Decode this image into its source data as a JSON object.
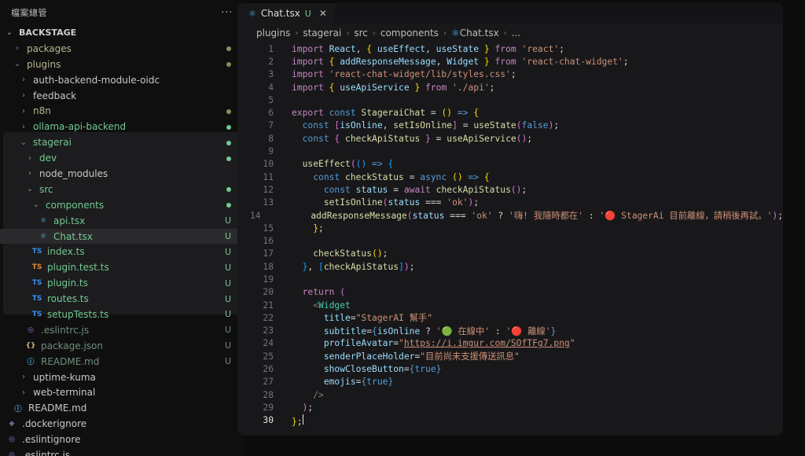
{
  "explorer": {
    "title": "檔案總管",
    "more": "···",
    "root": "BACKSTAGE",
    "items": [
      {
        "label": "packages",
        "depth": 1,
        "type": "folder",
        "open": false,
        "status": "dot",
        "color": "olive"
      },
      {
        "label": "plugins",
        "depth": 1,
        "type": "folder",
        "open": true,
        "status": "dot",
        "color": "olive"
      },
      {
        "label": "auth-backend-module-oidc",
        "depth": 2,
        "type": "folder",
        "open": false,
        "status": "",
        "color": "normal"
      },
      {
        "label": "feedback",
        "depth": 2,
        "type": "folder",
        "open": false,
        "status": "",
        "color": "normal"
      },
      {
        "label": "n8n",
        "depth": 2,
        "type": "folder",
        "open": false,
        "status": "dot",
        "color": "olive"
      },
      {
        "label": "ollama-api-backend",
        "depth": 2,
        "type": "folder",
        "open": false,
        "status": "dot",
        "color": "green"
      },
      {
        "label": "stagerai",
        "depth": 2,
        "type": "folder",
        "open": true,
        "status": "dot",
        "color": "green"
      },
      {
        "label": "dev",
        "depth": 3,
        "type": "folder",
        "open": false,
        "status": "dot",
        "color": "green"
      },
      {
        "label": "node_modules",
        "depth": 3,
        "type": "folder",
        "open": false,
        "status": "",
        "color": "normal"
      },
      {
        "label": "src",
        "depth": 3,
        "type": "folder",
        "open": true,
        "status": "dot",
        "color": "green"
      },
      {
        "label": "components",
        "depth": 4,
        "type": "folder",
        "open": true,
        "status": "dot",
        "color": "green"
      },
      {
        "label": "api.tsx",
        "depth": 5,
        "type": "react",
        "status": "U",
        "color": "green"
      },
      {
        "label": "Chat.tsx",
        "depth": 5,
        "type": "react",
        "status": "U",
        "color": "green",
        "selected": true
      },
      {
        "label": "index.ts",
        "depth": 4,
        "type": "ts",
        "status": "U",
        "color": "green"
      },
      {
        "label": "plugin.test.ts",
        "depth": 4,
        "type": "tstest",
        "status": "U",
        "color": "green"
      },
      {
        "label": "plugin.ts",
        "depth": 4,
        "type": "ts",
        "status": "U",
        "color": "green"
      },
      {
        "label": "routes.ts",
        "depth": 4,
        "type": "ts",
        "status": "U",
        "color": "green"
      },
      {
        "label": "setupTests.ts",
        "depth": 4,
        "type": "ts",
        "status": "U",
        "color": "green"
      },
      {
        "label": ".eslintrc.js",
        "depth": 3,
        "type": "eslint",
        "status": "U",
        "color": "dim"
      },
      {
        "label": "package.json",
        "depth": 3,
        "type": "json",
        "status": "U",
        "color": "dim"
      },
      {
        "label": "README.md",
        "depth": 3,
        "type": "info",
        "status": "U",
        "color": "dim"
      },
      {
        "label": "uptime-kuma",
        "depth": 2,
        "type": "folder",
        "open": false,
        "status": "",
        "color": "normal"
      },
      {
        "label": "web-terminal",
        "depth": 2,
        "type": "folder",
        "open": false,
        "status": "",
        "color": "normal"
      },
      {
        "label": "README.md",
        "depth": 1,
        "type": "info",
        "status": "",
        "color": "normal"
      },
      {
        "label": ".dockerignore",
        "depth": 0,
        "type": "docker",
        "status": "",
        "color": "normal"
      },
      {
        "label": ".eslintignore",
        "depth": 0,
        "type": "eslint",
        "status": "",
        "color": "normal"
      },
      {
        "label": ".eslintrc.js",
        "depth": 0,
        "type": "eslint",
        "status": "",
        "color": "normal"
      }
    ]
  },
  "editor": {
    "tab": {
      "label": "Chat.tsx",
      "modified": "U",
      "close": "✕"
    },
    "breadcrumb": [
      "plugins",
      "stagerai",
      "src",
      "components",
      "Chat.tsx",
      "..."
    ],
    "active_line": 30,
    "lines": [
      [
        [
          "k",
          "import "
        ],
        [
          "v",
          "React"
        ],
        [
          "p",
          ", "
        ],
        [
          "br1",
          "{ "
        ],
        [
          "v",
          "useEffect"
        ],
        [
          "p",
          ", "
        ],
        [
          "v",
          "useState"
        ],
        [
          "br1",
          " }"
        ],
        [
          "k",
          " from "
        ],
        [
          "s",
          "'react'"
        ],
        [
          "p",
          ";"
        ]
      ],
      [
        [
          "k",
          "import "
        ],
        [
          "br1",
          "{ "
        ],
        [
          "v",
          "addResponseMessage"
        ],
        [
          "p",
          ", "
        ],
        [
          "v",
          "Widget"
        ],
        [
          "br1",
          " }"
        ],
        [
          "k",
          " from "
        ],
        [
          "s",
          "'react-chat-widget'"
        ],
        [
          "p",
          ";"
        ]
      ],
      [
        [
          "k",
          "import "
        ],
        [
          "s",
          "'react-chat-widget/lib/styles.css'"
        ],
        [
          "p",
          ";"
        ]
      ],
      [
        [
          "k",
          "import "
        ],
        [
          "br1",
          "{ "
        ],
        [
          "v",
          "useApiService"
        ],
        [
          "br1",
          " }"
        ],
        [
          "k",
          " from "
        ],
        [
          "s",
          "'./api'"
        ],
        [
          "p",
          ";"
        ]
      ],
      [],
      [
        [
          "k",
          "export "
        ],
        [
          "k2",
          "const "
        ],
        [
          "f",
          "StageraiChat"
        ],
        [
          "p",
          " = "
        ],
        [
          "br1",
          "("
        ],
        [
          "br1",
          ")"
        ],
        [
          "k2",
          " => "
        ],
        [
          "br1",
          "{"
        ]
      ],
      [
        [
          "p",
          "  "
        ],
        [
          "k2",
          "const "
        ],
        [
          "br2",
          "["
        ],
        [
          "v",
          "isOnline"
        ],
        [
          "p",
          ", "
        ],
        [
          "f",
          "setIsOnline"
        ],
        [
          "br2",
          "]"
        ],
        [
          "p",
          " = "
        ],
        [
          "f",
          "useState"
        ],
        [
          "br2",
          "("
        ],
        [
          "k2",
          "false"
        ],
        [
          "br2",
          ")"
        ],
        [
          "p",
          ";"
        ]
      ],
      [
        [
          "p",
          "  "
        ],
        [
          "k2",
          "const "
        ],
        [
          "br2",
          "{ "
        ],
        [
          "f",
          "checkApiStatus"
        ],
        [
          "br2",
          " }"
        ],
        [
          "p",
          " = "
        ],
        [
          "f",
          "useApiService"
        ],
        [
          "br2",
          "()"
        ],
        [
          "p",
          ";"
        ]
      ],
      [],
      [
        [
          "p",
          "  "
        ],
        [
          "f",
          "useEffect"
        ],
        [
          "br2",
          "("
        ],
        [
          "br3",
          "()"
        ],
        [
          "k2",
          " => "
        ],
        [
          "br3",
          "{"
        ]
      ],
      [
        [
          "p",
          "    "
        ],
        [
          "k2",
          "const "
        ],
        [
          "f",
          "checkStatus"
        ],
        [
          "p",
          " = "
        ],
        [
          "k2",
          "async "
        ],
        [
          "br1",
          "()"
        ],
        [
          "k2",
          " => "
        ],
        [
          "br1",
          "{"
        ]
      ],
      [
        [
          "p",
          "      "
        ],
        [
          "k2",
          "const "
        ],
        [
          "v",
          "status"
        ],
        [
          "p",
          " = "
        ],
        [
          "k",
          "await "
        ],
        [
          "f",
          "checkApiStatus"
        ],
        [
          "br2",
          "()"
        ],
        [
          "p",
          ";"
        ]
      ],
      [
        [
          "p",
          "      "
        ],
        [
          "f",
          "setIsOnline"
        ],
        [
          "br2",
          "("
        ],
        [
          "v",
          "status"
        ],
        [
          "p",
          " === "
        ],
        [
          "s",
          "'ok'"
        ],
        [
          "br2",
          ")"
        ],
        [
          "p",
          ";"
        ]
      ],
      [
        [
          "p",
          "      "
        ],
        [
          "f",
          "addResponseMessage"
        ],
        [
          "br2",
          "("
        ],
        [
          "v",
          "status"
        ],
        [
          "p",
          " === "
        ],
        [
          "s",
          "'ok'"
        ],
        [
          "p",
          " ? "
        ],
        [
          "s",
          "'嗨! 我隨時都在'"
        ],
        [
          "p",
          " : "
        ],
        [
          "s",
          "'🔴 StagerAi 目前離線，請稍後再試。'"
        ],
        [
          "br2",
          ")"
        ],
        [
          "p",
          ";"
        ]
      ],
      [
        [
          "p",
          "    "
        ],
        [
          "br1",
          "}"
        ],
        [
          "p",
          ";"
        ]
      ],
      [],
      [
        [
          "p",
          "    "
        ],
        [
          "f",
          "checkStatus"
        ],
        [
          "br1",
          "()"
        ],
        [
          "p",
          ";"
        ]
      ],
      [
        [
          "p",
          "  "
        ],
        [
          "br3",
          "}"
        ],
        [
          "p",
          ", "
        ],
        [
          "br3",
          "["
        ],
        [
          "f",
          "checkApiStatus"
        ],
        [
          "br3",
          "]"
        ],
        [
          "br2",
          ")"
        ],
        [
          "p",
          ";"
        ]
      ],
      [],
      [
        [
          "p",
          "  "
        ],
        [
          "k",
          "return "
        ],
        [
          "br2",
          "("
        ]
      ],
      [
        [
          "p",
          "    "
        ],
        [
          "cm",
          "<"
        ],
        [
          "tg",
          "Widget"
        ]
      ],
      [
        [
          "p",
          "      "
        ],
        [
          "v",
          "title"
        ],
        [
          "p",
          "="
        ],
        [
          "s",
          "\"StagerAI 幫手\""
        ]
      ],
      [
        [
          "p",
          "      "
        ],
        [
          "v",
          "subtitle"
        ],
        [
          "p",
          "="
        ],
        [
          "k2",
          "{"
        ],
        [
          "v",
          "isOnline"
        ],
        [
          "p",
          " ? "
        ],
        [
          "s",
          "'🟢 在線中'"
        ],
        [
          "p",
          " : "
        ],
        [
          "s",
          "'🔴 離線'"
        ],
        [
          "k2",
          "}"
        ]
      ],
      [
        [
          "p",
          "      "
        ],
        [
          "v",
          "profileAvatar"
        ],
        [
          "p",
          "="
        ],
        [
          "s",
          "\""
        ],
        [
          "u",
          "https://i.imgur.com/SOfTFg7.png"
        ],
        [
          "s",
          "\""
        ]
      ],
      [
        [
          "p",
          "      "
        ],
        [
          "v",
          "senderPlaceHolder"
        ],
        [
          "p",
          "="
        ],
        [
          "s",
          "\"目前尚未支援傳送訊息\""
        ]
      ],
      [
        [
          "p",
          "      "
        ],
        [
          "v",
          "showCloseButton"
        ],
        [
          "p",
          "="
        ],
        [
          "k2",
          "{true}"
        ]
      ],
      [
        [
          "p",
          "      "
        ],
        [
          "v",
          "emojis"
        ],
        [
          "p",
          "="
        ],
        [
          "k2",
          "{true}"
        ]
      ],
      [
        [
          "p",
          "    "
        ],
        [
          "cm",
          "/>"
        ]
      ],
      [
        [
          "p",
          "  "
        ],
        [
          "br2",
          ")"
        ],
        [
          "p",
          ";"
        ]
      ],
      [
        [
          "br1",
          "}"
        ],
        [
          "p",
          ";"
        ]
      ]
    ]
  }
}
